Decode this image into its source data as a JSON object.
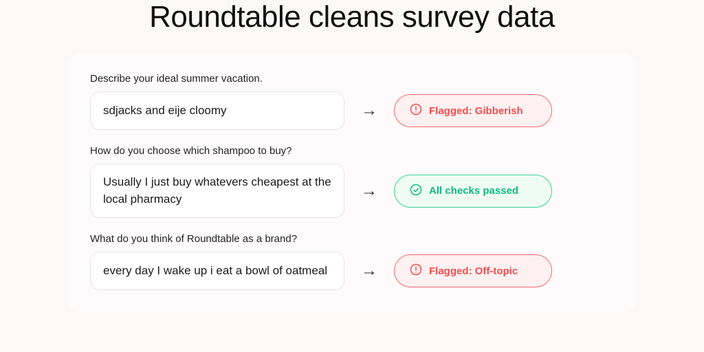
{
  "title": "Roundtable cleans survey data",
  "rows": [
    {
      "question": "Describe your ideal summer vacation.",
      "answer": "sdjacks and eije cloomy",
      "status": "flag",
      "status_label": "Flagged: Gibberish"
    },
    {
      "question": "How do you choose which shampoo to buy?",
      "answer": "Usually I just buy whatevers cheapest at the local pharmacy",
      "status": "ok",
      "status_label": "All checks passed"
    },
    {
      "question": "What do you think of Roundtable as a brand?",
      "answer": "every day I wake up i eat a bowl of oatmeal",
      "status": "flag",
      "status_label": "Flagged: Off-topic"
    }
  ],
  "colors": {
    "flag_fg": "#f04d4d",
    "flag_border": "#f26a6a",
    "flag_bg": "#fff1f1",
    "ok_fg": "#10b981",
    "ok_border": "#34d399",
    "ok_bg": "#eefcf4"
  }
}
